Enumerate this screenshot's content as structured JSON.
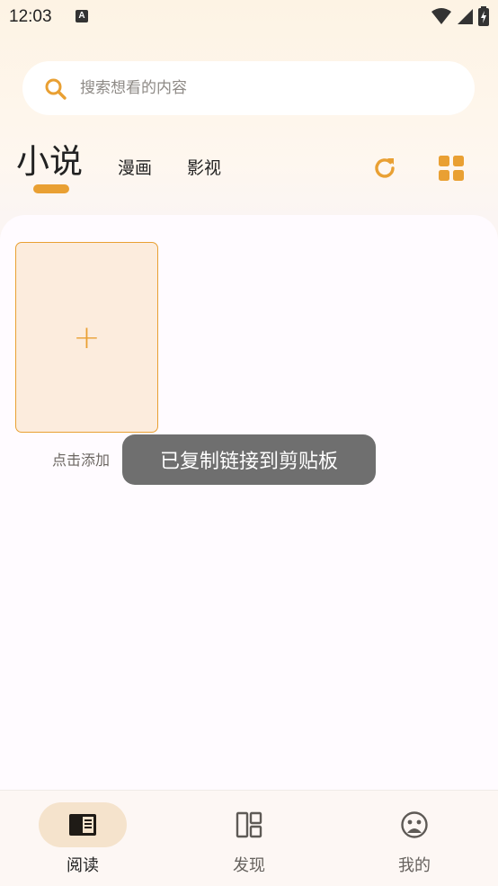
{
  "status_bar": {
    "time": "12:03",
    "notification_glyph": "A"
  },
  "search": {
    "placeholder": "搜索想看的内容"
  },
  "tabs": [
    {
      "label": "小说",
      "active": true
    },
    {
      "label": "漫画",
      "active": false
    },
    {
      "label": "影视",
      "active": false
    }
  ],
  "actions": {
    "refresh_icon": "refresh-icon",
    "grid_icon": "grid-view-icon"
  },
  "bookshelf": {
    "add_symbol": "+",
    "add_label": "点击添加"
  },
  "toast": {
    "message": "已复制链接到剪贴板"
  },
  "bottom_nav": [
    {
      "label": "阅读",
      "icon": "book-icon",
      "active": true
    },
    {
      "label": "发现",
      "icon": "dashboard-icon",
      "active": false
    },
    {
      "label": "我的",
      "icon": "face-icon",
      "active": false
    }
  ],
  "colors": {
    "accent": "#e9a033",
    "card_bg": "#fcecdd",
    "toast_bg": "#6f6f6f",
    "nav_pill": "#f5e3cc"
  }
}
